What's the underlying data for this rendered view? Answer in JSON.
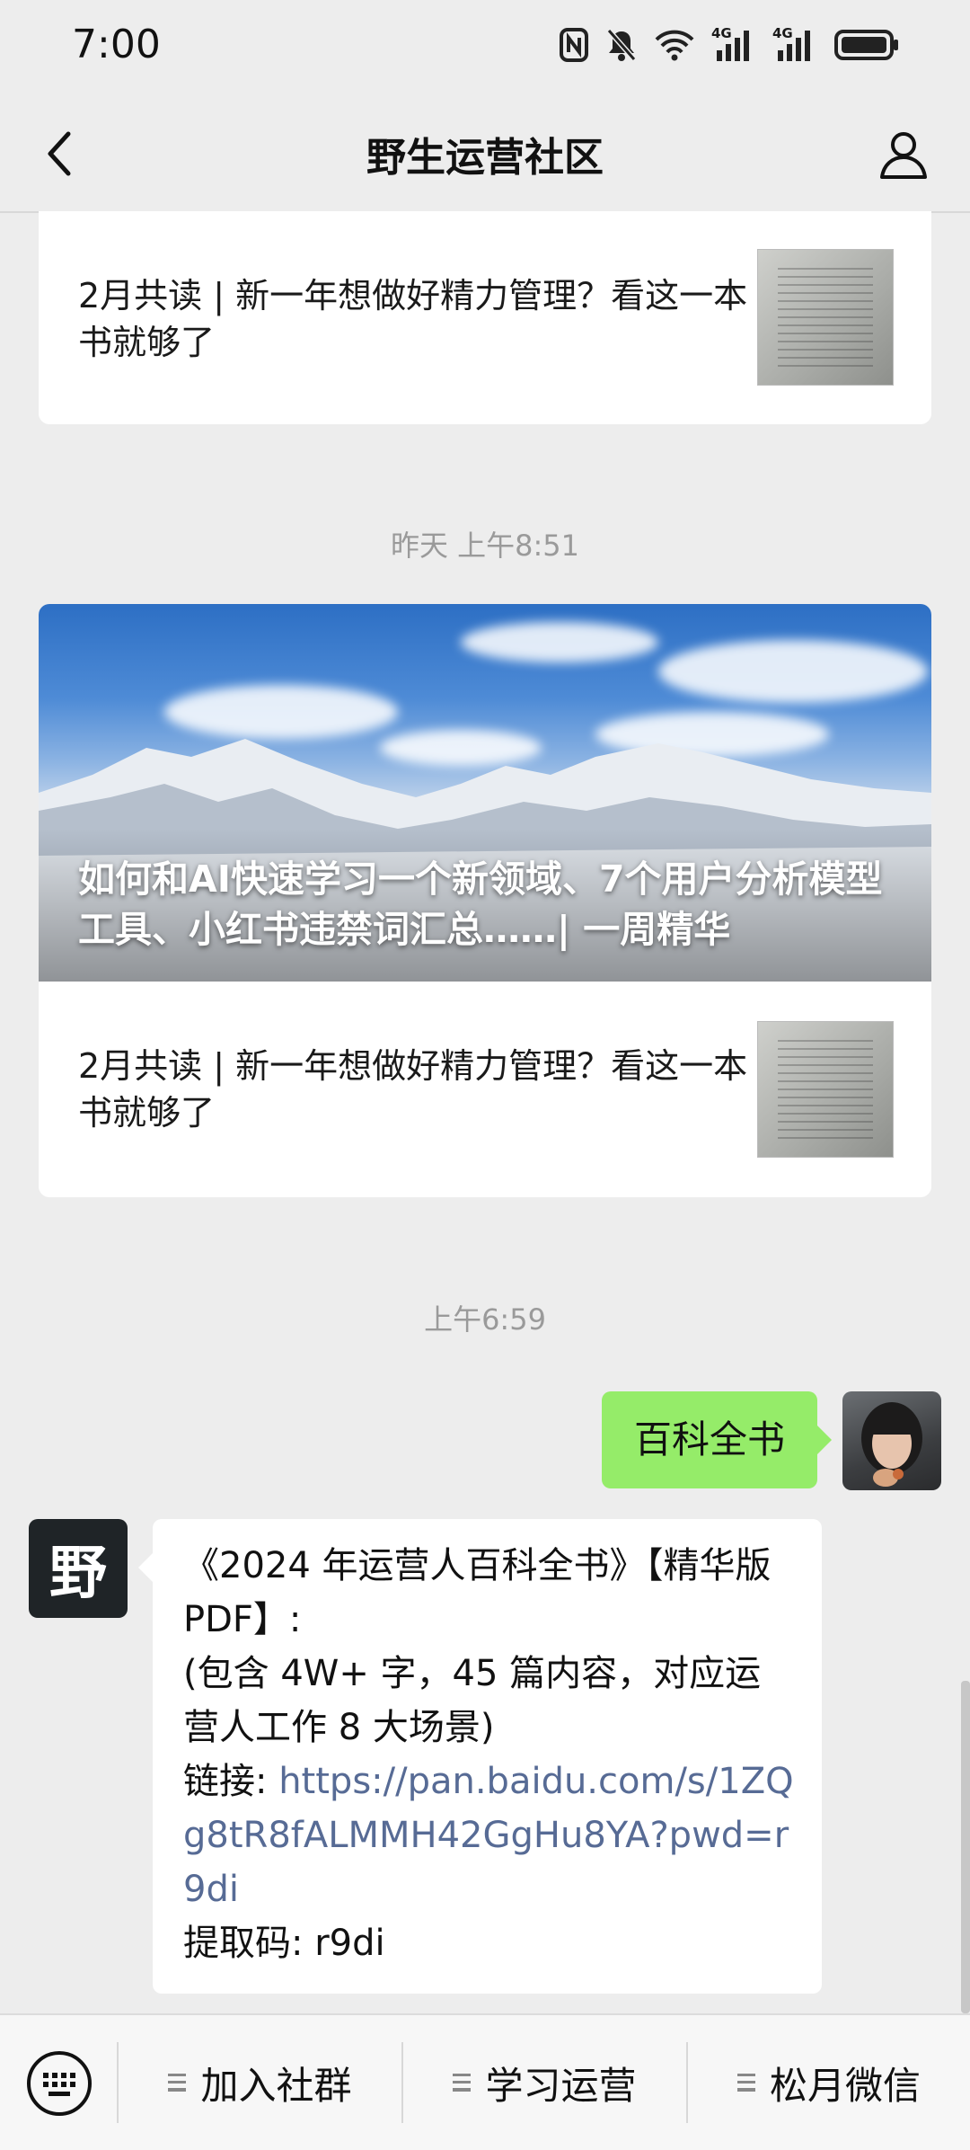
{
  "status_bar": {
    "time": "7:00",
    "net1": "4G",
    "net2": "4G"
  },
  "nav": {
    "title": "野生运营社区"
  },
  "cards": [
    {
      "sub_title": "2月共读 | 新一年想做好精力管理？看这一本书就够了"
    },
    {
      "hero_title": "如何和AI快速学习一个新领域、7个用户分析模型工具、小红书违禁词汇总……| 一周精华",
      "sub_title": "2月共读 | 新一年想做好精力管理？看这一本书就够了"
    }
  ],
  "timestamps": {
    "t1": "昨天 上午8:51",
    "t2": "上午6:59"
  },
  "chat": {
    "me_message": "百科全书",
    "reply_line1": "《2024 年运营人百科全书》【精华版 PDF】:",
    "reply_line2": "(包含 4W+ 字，45 篇内容，对应运营人工作 8 大场景)",
    "reply_link_label": "链接: ",
    "reply_link": "https://pan.baidu.com/s/1ZQg8tR8fALMMH42GgHu8YA?pwd=r9di",
    "reply_code": "提取码: r9di",
    "official_avatar_text": "野"
  },
  "bottom_menu": {
    "items": [
      {
        "label": "加入社群"
      },
      {
        "label": "学习运营"
      },
      {
        "label": "松月微信"
      }
    ]
  },
  "colors": {
    "my_bubble": "#95ec69",
    "link": "#576b95",
    "background": "#ededed"
  }
}
